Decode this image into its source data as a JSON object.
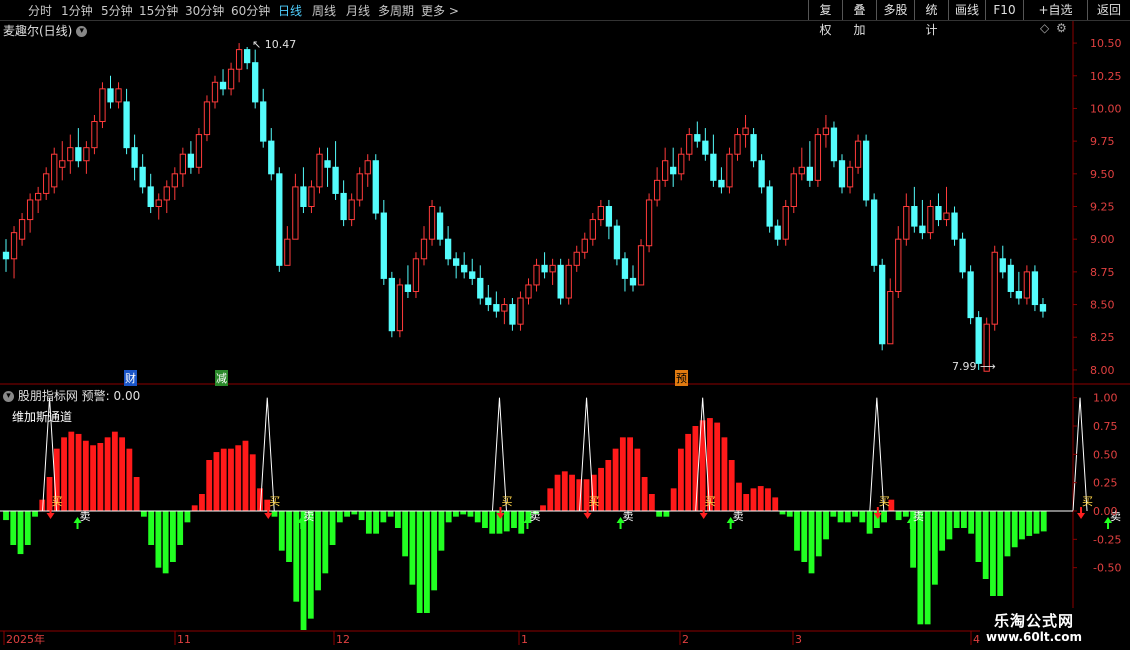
{
  "toolbar": {
    "periods": [
      "分时",
      "1分钟",
      "5分钟",
      "15分钟",
      "30分钟",
      "60分钟",
      "日线",
      "周线",
      "月线",
      "多周期",
      "更多 >"
    ],
    "active_period": "日线",
    "right_buttons": [
      "复权",
      "叠加",
      "多股",
      "统计",
      "画线",
      "F10",
      "+自选",
      "返回"
    ]
  },
  "main_panel": {
    "title": "麦趣尔(日线)",
    "high_marker": "10.47",
    "low_marker": "7.99",
    "event_markers": [
      "财",
      "减",
      "预"
    ],
    "price_axis": [
      "10.50",
      "10.25",
      "10.00",
      "9.75",
      "9.50",
      "9.25",
      "9.00",
      "8.75",
      "8.50",
      "8.25",
      "8.00"
    ]
  },
  "indicator_panel": {
    "title": "股朋指标网",
    "alert_label": "预警: 0.00",
    "subtitle": "维加斯通道",
    "axis": [
      "1.00",
      "0.75",
      "0.50",
      "0.25",
      "0.00",
      "-0.25",
      "-0.50"
    ],
    "buy_label": "买",
    "sell_label": "卖"
  },
  "time_axis": [
    "2025年",
    "11",
    "12",
    "1",
    "2",
    "3",
    "4"
  ],
  "watermark": {
    "title": "乐淘公式网",
    "url": "www.60lt.com"
  },
  "colors": {
    "up": "#ff3b3b",
    "down": "#54fcfc",
    "hist_up": "#ff1a1a",
    "hist_down": "#22ff22",
    "grid": "#8b0000"
  },
  "chart_data": {
    "type": "candlestick",
    "price_range": [
      7.9,
      10.6
    ],
    "candles": [
      {
        "o": 8.9,
        "h": 9.0,
        "l": 8.75,
        "c": 8.85
      },
      {
        "o": 8.85,
        "h": 9.1,
        "l": 8.7,
        "c": 9.05
      },
      {
        "o": 9.0,
        "h": 9.2,
        "l": 8.95,
        "c": 9.15
      },
      {
        "o": 9.15,
        "h": 9.35,
        "l": 9.05,
        "c": 9.3
      },
      {
        "o": 9.3,
        "h": 9.4,
        "l": 9.2,
        "c": 9.35
      },
      {
        "o": 9.35,
        "h": 9.55,
        "l": 9.3,
        "c": 9.5
      },
      {
        "o": 9.4,
        "h": 9.7,
        "l": 9.35,
        "c": 9.65
      },
      {
        "o": 9.55,
        "h": 9.75,
        "l": 9.45,
        "c": 9.6
      },
      {
        "o": 9.6,
        "h": 9.8,
        "l": 9.5,
        "c": 9.7
      },
      {
        "o": 9.7,
        "h": 9.85,
        "l": 9.55,
        "c": 9.6
      },
      {
        "o": 9.6,
        "h": 9.75,
        "l": 9.5,
        "c": 9.7
      },
      {
        "o": 9.7,
        "h": 9.95,
        "l": 9.65,
        "c": 9.9
      },
      {
        "o": 9.9,
        "h": 10.2,
        "l": 9.85,
        "c": 10.15
      },
      {
        "o": 10.15,
        "h": 10.25,
        "l": 10.0,
        "c": 10.05
      },
      {
        "o": 10.05,
        "h": 10.2,
        "l": 10.0,
        "c": 10.15
      },
      {
        "o": 10.05,
        "h": 10.15,
        "l": 9.65,
        "c": 9.7
      },
      {
        "o": 9.7,
        "h": 9.8,
        "l": 9.45,
        "c": 9.55
      },
      {
        "o": 9.55,
        "h": 9.65,
        "l": 9.35,
        "c": 9.4
      },
      {
        "o": 9.4,
        "h": 9.5,
        "l": 9.2,
        "c": 9.25
      },
      {
        "o": 9.25,
        "h": 9.35,
        "l": 9.15,
        "c": 9.3
      },
      {
        "o": 9.3,
        "h": 9.45,
        "l": 9.2,
        "c": 9.4
      },
      {
        "o": 9.4,
        "h": 9.55,
        "l": 9.3,
        "c": 9.5
      },
      {
        "o": 9.5,
        "h": 9.7,
        "l": 9.4,
        "c": 9.65
      },
      {
        "o": 9.65,
        "h": 9.75,
        "l": 9.5,
        "c": 9.55
      },
      {
        "o": 9.55,
        "h": 9.85,
        "l": 9.5,
        "c": 9.8
      },
      {
        "o": 9.8,
        "h": 10.1,
        "l": 9.75,
        "c": 10.05
      },
      {
        "o": 10.05,
        "h": 10.25,
        "l": 10.0,
        "c": 10.2
      },
      {
        "o": 10.2,
        "h": 10.3,
        "l": 10.1,
        "c": 10.15
      },
      {
        "o": 10.15,
        "h": 10.35,
        "l": 10.1,
        "c": 10.3
      },
      {
        "o": 10.3,
        "h": 10.5,
        "l": 10.2,
        "c": 10.45
      },
      {
        "o": 10.45,
        "h": 10.47,
        "l": 10.3,
        "c": 10.35
      },
      {
        "o": 10.35,
        "h": 10.45,
        "l": 10.0,
        "c": 10.05
      },
      {
        "o": 10.05,
        "h": 10.15,
        "l": 9.7,
        "c": 9.75
      },
      {
        "o": 9.75,
        "h": 9.85,
        "l": 9.45,
        "c": 9.5
      },
      {
        "o": 9.5,
        "h": 9.55,
        "l": 8.75,
        "c": 8.8
      },
      {
        "o": 8.8,
        "h": 9.1,
        "l": 8.8,
        "c": 9.0
      },
      {
        "o": 9.0,
        "h": 9.5,
        "l": 9.0,
        "c": 9.4
      },
      {
        "o": 9.4,
        "h": 9.55,
        "l": 9.2,
        "c": 9.25
      },
      {
        "o": 9.25,
        "h": 9.45,
        "l": 9.2,
        "c": 9.4
      },
      {
        "o": 9.4,
        "h": 9.7,
        "l": 9.35,
        "c": 9.65
      },
      {
        "o": 9.6,
        "h": 9.7,
        "l": 9.4,
        "c": 9.55
      },
      {
        "o": 9.55,
        "h": 9.75,
        "l": 9.3,
        "c": 9.35
      },
      {
        "o": 9.35,
        "h": 9.45,
        "l": 9.1,
        "c": 9.15
      },
      {
        "o": 9.15,
        "h": 9.35,
        "l": 9.1,
        "c": 9.3
      },
      {
        "o": 9.3,
        "h": 9.55,
        "l": 9.25,
        "c": 9.5
      },
      {
        "o": 9.5,
        "h": 9.65,
        "l": 9.4,
        "c": 9.6
      },
      {
        "o": 9.6,
        "h": 9.65,
        "l": 9.15,
        "c": 9.2
      },
      {
        "o": 9.2,
        "h": 9.3,
        "l": 8.65,
        "c": 8.7
      },
      {
        "o": 8.7,
        "h": 8.75,
        "l": 8.25,
        "c": 8.3
      },
      {
        "o": 8.3,
        "h": 8.7,
        "l": 8.25,
        "c": 8.65
      },
      {
        "o": 8.65,
        "h": 8.8,
        "l": 8.55,
        "c": 8.6
      },
      {
        "o": 8.6,
        "h": 8.9,
        "l": 8.55,
        "c": 8.85
      },
      {
        "o": 8.85,
        "h": 9.1,
        "l": 8.8,
        "c": 9.0
      },
      {
        "o": 9.0,
        "h": 9.3,
        "l": 8.95,
        "c": 9.25
      },
      {
        "o": 9.2,
        "h": 9.25,
        "l": 8.95,
        "c": 9.0
      },
      {
        "o": 9.0,
        "h": 9.1,
        "l": 8.8,
        "c": 8.85
      },
      {
        "o": 8.85,
        "h": 8.9,
        "l": 8.7,
        "c": 8.8
      },
      {
        "o": 8.8,
        "h": 8.9,
        "l": 8.7,
        "c": 8.75
      },
      {
        "o": 8.75,
        "h": 8.85,
        "l": 8.65,
        "c": 8.7
      },
      {
        "o": 8.7,
        "h": 8.8,
        "l": 8.5,
        "c": 8.55
      },
      {
        "o": 8.55,
        "h": 8.65,
        "l": 8.45,
        "c": 8.5
      },
      {
        "o": 8.5,
        "h": 8.6,
        "l": 8.4,
        "c": 8.45
      },
      {
        "o": 8.45,
        "h": 8.55,
        "l": 8.35,
        "c": 8.5
      },
      {
        "o": 8.5,
        "h": 8.55,
        "l": 8.3,
        "c": 8.35
      },
      {
        "o": 8.35,
        "h": 8.6,
        "l": 8.3,
        "c": 8.55
      },
      {
        "o": 8.55,
        "h": 8.7,
        "l": 8.5,
        "c": 8.65
      },
      {
        "o": 8.65,
        "h": 8.85,
        "l": 8.6,
        "c": 8.8
      },
      {
        "o": 8.8,
        "h": 8.9,
        "l": 8.7,
        "c": 8.75
      },
      {
        "o": 8.75,
        "h": 8.85,
        "l": 8.65,
        "c": 8.8
      },
      {
        "o": 8.8,
        "h": 8.85,
        "l": 8.5,
        "c": 8.55
      },
      {
        "o": 8.55,
        "h": 8.85,
        "l": 8.5,
        "c": 8.8
      },
      {
        "o": 8.8,
        "h": 8.95,
        "l": 8.75,
        "c": 8.9
      },
      {
        "o": 8.9,
        "h": 9.05,
        "l": 8.85,
        "c": 9.0
      },
      {
        "o": 9.0,
        "h": 9.2,
        "l": 8.95,
        "c": 9.15
      },
      {
        "o": 9.15,
        "h": 9.3,
        "l": 9.1,
        "c": 9.25
      },
      {
        "o": 9.25,
        "h": 9.3,
        "l": 9.0,
        "c": 9.1
      },
      {
        "o": 9.1,
        "h": 9.15,
        "l": 8.8,
        "c": 8.85
      },
      {
        "o": 8.85,
        "h": 8.9,
        "l": 8.6,
        "c": 8.7
      },
      {
        "o": 8.7,
        "h": 8.8,
        "l": 8.6,
        "c": 8.65
      },
      {
        "o": 8.65,
        "h": 9.0,
        "l": 8.65,
        "c": 8.95
      },
      {
        "o": 8.95,
        "h": 9.35,
        "l": 8.9,
        "c": 9.3
      },
      {
        "o": 9.3,
        "h": 9.55,
        "l": 9.25,
        "c": 9.45
      },
      {
        "o": 9.45,
        "h": 9.7,
        "l": 9.4,
        "c": 9.6
      },
      {
        "o": 9.55,
        "h": 9.7,
        "l": 9.4,
        "c": 9.5
      },
      {
        "o": 9.5,
        "h": 9.7,
        "l": 9.45,
        "c": 9.65
      },
      {
        "o": 9.65,
        "h": 9.85,
        "l": 9.6,
        "c": 9.8
      },
      {
        "o": 9.8,
        "h": 9.9,
        "l": 9.7,
        "c": 9.75
      },
      {
        "o": 9.75,
        "h": 9.85,
        "l": 9.6,
        "c": 9.65
      },
      {
        "o": 9.65,
        "h": 9.8,
        "l": 9.4,
        "c": 9.45
      },
      {
        "o": 9.45,
        "h": 9.55,
        "l": 9.35,
        "c": 9.4
      },
      {
        "o": 9.4,
        "h": 9.7,
        "l": 9.35,
        "c": 9.65
      },
      {
        "o": 9.65,
        "h": 9.85,
        "l": 9.6,
        "c": 9.8
      },
      {
        "o": 9.8,
        "h": 9.95,
        "l": 9.7,
        "c": 9.85
      },
      {
        "o": 9.8,
        "h": 9.85,
        "l": 9.55,
        "c": 9.6
      },
      {
        "o": 9.6,
        "h": 9.65,
        "l": 9.35,
        "c": 9.4
      },
      {
        "o": 9.4,
        "h": 9.45,
        "l": 9.05,
        "c": 9.1
      },
      {
        "o": 9.1,
        "h": 9.15,
        "l": 8.95,
        "c": 9.0
      },
      {
        "o": 9.0,
        "h": 9.3,
        "l": 8.95,
        "c": 9.25
      },
      {
        "o": 9.25,
        "h": 9.55,
        "l": 9.2,
        "c": 9.5
      },
      {
        "o": 9.5,
        "h": 9.7,
        "l": 9.45,
        "c": 9.55
      },
      {
        "o": 9.55,
        "h": 9.75,
        "l": 9.4,
        "c": 9.45
      },
      {
        "o": 9.45,
        "h": 9.85,
        "l": 9.4,
        "c": 9.8
      },
      {
        "o": 9.8,
        "h": 9.95,
        "l": 9.7,
        "c": 9.85
      },
      {
        "o": 9.85,
        "h": 9.9,
        "l": 9.55,
        "c": 9.6
      },
      {
        "o": 9.6,
        "h": 9.65,
        "l": 9.35,
        "c": 9.4
      },
      {
        "o": 9.4,
        "h": 9.6,
        "l": 9.35,
        "c": 9.55
      },
      {
        "o": 9.55,
        "h": 9.8,
        "l": 9.5,
        "c": 9.75
      },
      {
        "o": 9.75,
        "h": 9.8,
        "l": 9.25,
        "c": 9.3
      },
      {
        "o": 9.3,
        "h": 9.35,
        "l": 8.75,
        "c": 8.8
      },
      {
        "o": 8.8,
        "h": 8.85,
        "l": 8.15,
        "c": 8.2
      },
      {
        "o": 8.2,
        "h": 8.7,
        "l": 8.2,
        "c": 8.6
      },
      {
        "o": 8.6,
        "h": 9.1,
        "l": 8.55,
        "c": 9.0
      },
      {
        "o": 9.0,
        "h": 9.35,
        "l": 8.95,
        "c": 9.25
      },
      {
        "o": 9.25,
        "h": 9.4,
        "l": 9.05,
        "c": 9.1
      },
      {
        "o": 9.1,
        "h": 9.3,
        "l": 9.0,
        "c": 9.05
      },
      {
        "o": 9.05,
        "h": 9.3,
        "l": 9.0,
        "c": 9.25
      },
      {
        "o": 9.25,
        "h": 9.35,
        "l": 9.1,
        "c": 9.15
      },
      {
        "o": 9.15,
        "h": 9.4,
        "l": 9.1,
        "c": 9.2
      },
      {
        "o": 9.2,
        "h": 9.25,
        "l": 8.95,
        "c": 9.0
      },
      {
        "o": 9.0,
        "h": 9.05,
        "l": 8.7,
        "c": 8.75
      },
      {
        "o": 8.75,
        "h": 8.8,
        "l": 8.35,
        "c": 8.4
      },
      {
        "o": 8.4,
        "h": 8.45,
        "l": 8.0,
        "c": 8.05
      },
      {
        "o": 7.99,
        "h": 8.4,
        "l": 7.99,
        "c": 8.35
      },
      {
        "o": 8.35,
        "h": 8.95,
        "l": 8.3,
        "c": 8.9
      },
      {
        "o": 8.85,
        "h": 8.95,
        "l": 8.7,
        "c": 8.75
      },
      {
        "o": 8.8,
        "h": 8.85,
        "l": 8.55,
        "c": 8.6
      },
      {
        "o": 8.6,
        "h": 8.75,
        "l": 8.5,
        "c": 8.55
      },
      {
        "o": 8.55,
        "h": 8.8,
        "l": 8.5,
        "c": 8.75
      },
      {
        "o": 8.75,
        "h": 8.8,
        "l": 8.45,
        "c": 8.5
      },
      {
        "o": 8.5,
        "h": 8.55,
        "l": 8.4,
        "c": 8.45
      }
    ],
    "indicator_range": [
      -1.05,
      1.05
    ],
    "histogram": [
      -0.08,
      -0.3,
      -0.38,
      -0.3,
      -0.05,
      0.1,
      0.3,
      0.55,
      0.65,
      0.7,
      0.68,
      0.62,
      0.58,
      0.6,
      0.65,
      0.7,
      0.65,
      0.55,
      0.3,
      -0.05,
      -0.3,
      -0.5,
      -0.55,
      -0.45,
      -0.3,
      -0.1,
      0.05,
      0.15,
      0.45,
      0.52,
      0.55,
      0.55,
      0.58,
      0.62,
      0.5,
      0.2,
      0.1,
      -0.05,
      -0.35,
      -0.45,
      -0.8,
      -1.05,
      -0.95,
      -0.7,
      -0.55,
      -0.3,
      -0.1,
      -0.05,
      -0.03,
      -0.08,
      -0.2,
      -0.2,
      -0.1,
      -0.05,
      -0.15,
      -0.4,
      -0.65,
      -0.9,
      -0.9,
      -0.7,
      -0.35,
      -0.1,
      -0.05,
      -0.03,
      -0.05,
      -0.1,
      -0.15,
      -0.2,
      -0.2,
      -0.18,
      -0.15,
      -0.2,
      -0.1,
      -0.03,
      0.05,
      0.2,
      0.32,
      0.35,
      0.32,
      0.28,
      0.28,
      0.32,
      0.38,
      0.45,
      0.55,
      0.65,
      0.65,
      0.55,
      0.3,
      0.15,
      -0.05,
      -0.05,
      0.2,
      0.55,
      0.68,
      0.75,
      0.8,
      0.82,
      0.78,
      0.65,
      0.45,
      0.25,
      0.15,
      0.2,
      0.22,
      0.2,
      0.12,
      -0.03,
      -0.05,
      -0.35,
      -0.45,
      -0.55,
      -0.4,
      -0.25,
      -0.05,
      -0.1,
      -0.1,
      -0.05,
      -0.1,
      -0.2,
      -0.15,
      -0.1,
      0.1,
      -0.08,
      -0.05,
      -0.5,
      -1.0,
      -1.0,
      -0.65,
      -0.35,
      -0.25,
      -0.15,
      -0.15,
      -0.2,
      -0.45,
      -0.6,
      -0.75,
      -0.75,
      -0.4,
      -0.32,
      -0.25,
      -0.22,
      -0.2,
      -0.18
    ],
    "spike_bars": [
      6,
      36,
      68,
      80,
      96,
      120,
      148,
      156
    ]
  }
}
